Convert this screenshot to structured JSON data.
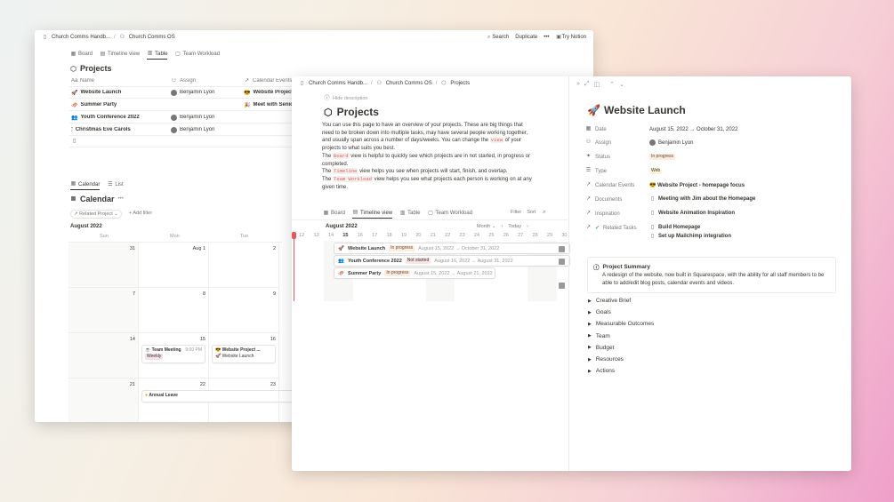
{
  "win1": {
    "breadcrumb": [
      "Church Comms Handb...",
      "Church Comms OS"
    ],
    "actions": {
      "search": "Search",
      "duplicate": "Duplicate",
      "more": "•••",
      "try": "Try Notion"
    },
    "tabs": [
      "Board",
      "Timeline view",
      "Table",
      "Team Workload"
    ],
    "title": "Projects",
    "columns": [
      "Name",
      "Assign",
      "Calendar Events"
    ],
    "rows": [
      {
        "icon": "🚀",
        "name": "Website Launch",
        "assign": "Benjamin Lyon",
        "event": "Website Project"
      },
      {
        "icon": "🛷",
        "name": "Summer Party",
        "assign": "",
        "event": "Meet with Senior"
      },
      {
        "icon": "👥",
        "name": "Youth Conference 2022",
        "assign": "Benjamin Lyon",
        "event": ""
      },
      {
        "icon": "🕯",
        "name": "Christmas Eve Carols",
        "assign": "Benjamin Lyon",
        "event": ""
      }
    ],
    "cal_tabs": [
      "Calendar",
      "List"
    ],
    "cal_title": "Calendar",
    "cal_more": "•••",
    "filter_related": "Related Project",
    "filter_add": "+ Add filter",
    "month": "August 2022",
    "days": [
      "Sun",
      "Mon",
      "Tue"
    ],
    "weeks": [
      [
        "31",
        "Aug 1",
        "2"
      ],
      [
        "7",
        "8",
        "9"
      ],
      [
        "14",
        "15",
        "16"
      ],
      [
        "21",
        "22",
        "23"
      ]
    ],
    "events": {
      "team_meeting": "Team Meeting",
      "team_meeting_time": "9:00 PM",
      "weekly": "Weekly",
      "website_project": "Website Project ...",
      "website_launch": "Website Launch",
      "annual_leave": "Annual Leave"
    }
  },
  "win2": {
    "breadcrumb": [
      "Church Comms Handb...",
      "Church Comms OS",
      "Projects"
    ],
    "hide_desc": "Hide description",
    "title": "Projects",
    "desc": {
      "p1": "You can use this page to have an overview of your projects. These are big things that need to be broken down into multiple tasks, may have several people working together, and usually span across a number of days/weeks. You can change the",
      "code_view": "view",
      "p1b": "of your projects to what suits you best.",
      "l2a": "The",
      "code_board": "Board",
      "l2b": "view is helpful to quickly see which projects are in not started, in progress or completed.",
      "code_timeline": "Timeline",
      "l3b": "view helps you see when projects will start, finish, and overlap.",
      "code_team": "Team Workload",
      "l4b": "view helps you see what projects each person is working on at any given time."
    },
    "tabs": [
      "Board",
      "Timeline view",
      "Table",
      "Team Workload"
    ],
    "tools": {
      "filter": "Filter",
      "sort": "Sort"
    },
    "tl_month": "August 2022",
    "tl_scale": "Month",
    "tl_today": "Today",
    "tl_days": [
      "12",
      "13",
      "14",
      "15",
      "16",
      "17",
      "18",
      "19",
      "20",
      "21",
      "22",
      "23",
      "24",
      "25",
      "26",
      "27",
      "28",
      "29",
      "30"
    ],
    "tl_items": [
      {
        "icon": "🚀",
        "name": "Website Launch",
        "status": "In progress",
        "dates": "August 15, 2022 → October 31, 2022"
      },
      {
        "icon": "👥",
        "name": "Youth Conference 2022",
        "status": "Not started",
        "dates": "August 16, 2022 → August 31, 2022"
      },
      {
        "icon": "🛷",
        "name": "Summer Party",
        "status": "In progress",
        "dates": "August 15, 2022 → August 21, 2022"
      }
    ],
    "page": {
      "icon": "🚀",
      "title": "Website Launch",
      "props": [
        {
          "k": "Date",
          "v": "August 15, 2022 → October 31, 2022"
        },
        {
          "k": "Assign",
          "v": "Benjamin Lyon"
        },
        {
          "k": "Status",
          "v": "In progress"
        },
        {
          "k": "Type",
          "v": "Web"
        },
        {
          "k": "Calendar Events",
          "v": "Website Project - homepage focus"
        },
        {
          "k": "Documents",
          "v": "Meeting with Jim about the Homepage"
        },
        {
          "k": "Inspiration",
          "v": "Website Animation Inspiration"
        },
        {
          "k": "Related Tasks",
          "v": "Build Homepage",
          "v2": "Set up Mailchimp integration"
        }
      ],
      "summary_title": "Project Summary",
      "summary": "A redesign of the website, now built in Squarespace, with the ability for all staff members to be able to add/edit blog posts, calendar events and videos.",
      "toggles": [
        "Creative Brief",
        "Goals",
        "Measurable Outcomes",
        "Team",
        "Budget",
        "Resources",
        "Actions"
      ]
    }
  },
  "colors": {
    "accent_red": "#eb5757",
    "status_progress": "#fbecdd",
    "status_not": "#fbe4e4"
  }
}
